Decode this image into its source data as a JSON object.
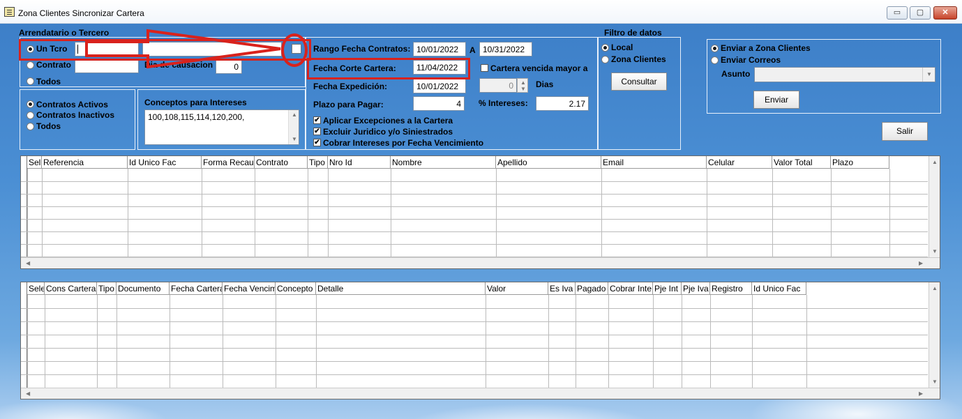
{
  "window": {
    "title": "Zona Clientes Sincronizar Cartera",
    "minimize": "▭",
    "maximize": "▢",
    "close": "✕"
  },
  "tercero": {
    "group_label": "Arrendatario o Tercero",
    "opt_un_tcro": "Un Tcro",
    "opt_contrato": "Contrato",
    "opt_todos": "Todos",
    "tcro_code": "",
    "tcro_name": "",
    "contrato_value": "",
    "dia_causacion_label": "Dia de causacion",
    "dia_causacion_value": "0",
    "selected": "Un Tcro"
  },
  "contratos": {
    "opt_activos": "Contratos Activos",
    "opt_inactivos": "Contratos Inactivos",
    "opt_todos": "Todos",
    "selected": "Contratos Activos"
  },
  "conceptos": {
    "label": "Conceptos para Intereses",
    "value": "100,108,115,114,120,200,"
  },
  "fechas": {
    "rango_label": "Rango Fecha Contratos:",
    "rango_desde": "10/01/2022",
    "rango_sep": "A",
    "rango_hasta": "10/31/2022",
    "corte_label": "Fecha Corte Cartera:",
    "corte_value": "11/04/2022",
    "expedicion_label": "Fecha Expedición:",
    "expedicion_value": "10/01/2022",
    "plazo_label": "Plazo para Pagar:",
    "plazo_value": "4",
    "vencida_label": "Cartera vencida mayor a",
    "vencida_value": "0",
    "dias_label": "Dias",
    "intereses_label": "% Intereses:",
    "intereses_value": "2.17"
  },
  "opciones": {
    "excepciones": "Aplicar Excepciones a la Cartera",
    "juridico": "Excluir Juridico y/o Siniestrados",
    "intereses_venc": "Cobrar Intereses por Fecha Vencimiento"
  },
  "filtro": {
    "label": "Filtro de datos",
    "opt_local": "Local",
    "opt_zona": "Zona Clientes",
    "consultar": "Consultar",
    "selected": "Local"
  },
  "envio": {
    "opt_zona": "Enviar a Zona Clientes",
    "opt_correos": "Enviar Correos",
    "asunto_label": "Asunto",
    "asunto_value": "",
    "enviar": "Enviar",
    "selected": "Enviar a Zona Clientes"
  },
  "salir": "Salir",
  "grid_contratos": {
    "columns": [
      "Sel",
      "Referencia",
      "Id Unico Fac",
      "Forma Recau",
      "Contrato",
      "Tipo",
      "Nro Id",
      "Nombre",
      "Apellido",
      "Email",
      "Celular",
      "Valor Total",
      "Plazo"
    ],
    "rows": []
  },
  "grid_cartera": {
    "columns": [
      "Sele",
      "Cons Cartera",
      "Tipo",
      "Documento",
      "Fecha Cartera",
      "Fecha Vencim",
      "Concepto",
      "Detalle",
      "Valor",
      "Es Iva",
      "Pagado",
      "Cobrar Inte",
      "Pje Int",
      "Pje Iva",
      "Registro",
      "Id Unico Fac"
    ],
    "rows": []
  },
  "colors": {
    "annotation_red": "#d9221c",
    "sky": "#4b8fd4"
  }
}
